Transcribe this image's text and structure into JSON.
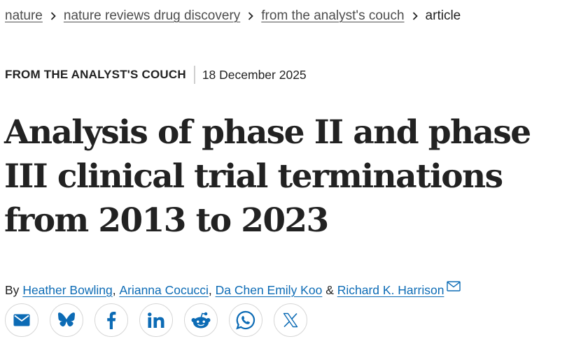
{
  "breadcrumb": {
    "items": [
      {
        "label": "nature"
      },
      {
        "label": "nature reviews drug discovery"
      },
      {
        "label": "from the analyst's couch"
      }
    ],
    "current": "article",
    "separator_icon": "chevron-right-icon"
  },
  "meta": {
    "article_type": "FROM THE ANALYST'S COUCH",
    "date": "18 December 2025"
  },
  "title": "Analysis of phase II and phase III clinical trial terminations from 2013 to 2023",
  "authors": {
    "by_label": "By",
    "names": [
      "Heather Bowling",
      "Arianna Cocucci",
      "Da Chen Emily Koo",
      "Richard K. Harrison"
    ],
    "sep_comma": ", ",
    "sep_and": " & ",
    "contact_icon": "envelope-icon"
  },
  "share": {
    "buttons": [
      {
        "icon": "email-icon"
      },
      {
        "icon": "bluesky-icon"
      },
      {
        "icon": "facebook-icon"
      },
      {
        "icon": "linkedin-icon"
      },
      {
        "icon": "reddit-icon"
      },
      {
        "icon": "whatsapp-icon"
      },
      {
        "icon": "x-icon"
      }
    ],
    "icon_color": "#0c6bb5"
  },
  "colors": {
    "text": "#222222",
    "link_blue": "#0c6bb5",
    "breadcrumb_link": "#4d4d4d",
    "divider": "#cfcfcf",
    "button_border": "#d6d6d6"
  }
}
